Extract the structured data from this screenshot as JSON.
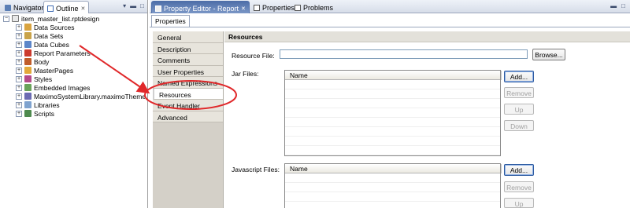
{
  "outline_view": {
    "tabs": [
      {
        "label": "Navigator",
        "icon": "navigator-icon"
      },
      {
        "label": "Outline",
        "icon": "outline-icon",
        "close": "✕"
      }
    ],
    "tree": {
      "root": "item_master_list.rptdesign",
      "children": [
        {
          "label": "Data Sources",
          "icon": "data-sources-icon",
          "color": "#d9a441"
        },
        {
          "label": "Data Sets",
          "icon": "data-sets-icon",
          "color": "#c9a34a"
        },
        {
          "label": "Data Cubes",
          "icon": "data-cubes-icon",
          "color": "#5c86c9"
        },
        {
          "label": "Report Parameters",
          "icon": "report-parameters-icon",
          "color": "#cc3b2e"
        },
        {
          "label": "Body",
          "icon": "body-icon",
          "color": "#c05c2b"
        },
        {
          "label": "MasterPages",
          "icon": "masterpages-icon",
          "color": "#e3a93b"
        },
        {
          "label": "Styles",
          "icon": "styles-icon",
          "color": "#b54a8a"
        },
        {
          "label": "Embedded Images",
          "icon": "embedded-images-icon",
          "color": "#6aa35a"
        },
        {
          "label": "MaximoSystemLibrary.maximoTheme",
          "icon": "theme-icon",
          "color": "#6b6bb3"
        },
        {
          "label": "Libraries",
          "icon": "libraries-icon",
          "color": "#7fa3cf"
        },
        {
          "label": "Scripts",
          "icon": "scripts-icon",
          "color": "#4e8a4e"
        }
      ]
    }
  },
  "editor": {
    "tabs": [
      {
        "label": "Property Editor - Report",
        "icon": "property-editor-icon",
        "close": "✕"
      },
      {
        "label": "Properties",
        "icon": "properties-icon"
      },
      {
        "label": "Problems",
        "icon": "problems-icon"
      }
    ],
    "sub_tab": "Properties",
    "categories": [
      "General",
      "Description",
      "Comments",
      "User Properties",
      "Named Expressions",
      "Resources",
      "Event Handler",
      "Advanced"
    ],
    "selected_category": "Resources",
    "section_title": "Resources",
    "resource_file": {
      "label": "Resource File:",
      "value": "",
      "browse": "Browse..."
    },
    "jar_files": {
      "label": "Jar Files:",
      "column": "Name",
      "buttons": {
        "add": "Add...",
        "remove": "Remove",
        "up": "Up",
        "down": "Down"
      }
    },
    "javascript_files": {
      "label": "Javascript Files:",
      "column": "Name",
      "buttons": {
        "add": "Add...",
        "remove": "Remove",
        "up": "Up"
      }
    }
  },
  "annotation": {
    "color": "#e0282a"
  }
}
